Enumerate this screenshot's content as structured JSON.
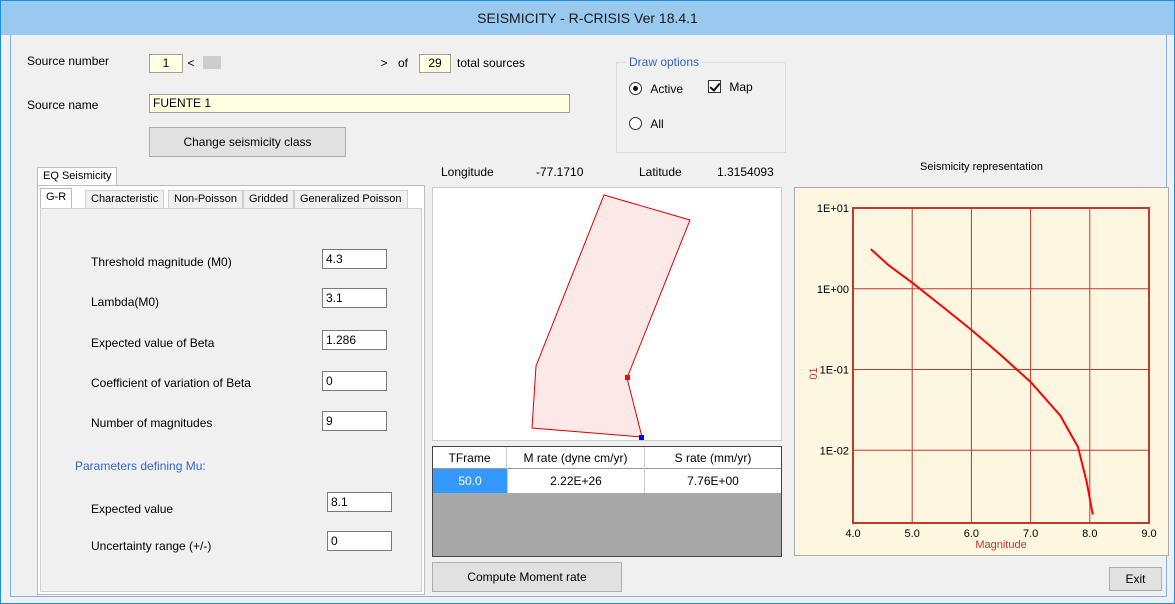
{
  "window": {
    "title": "SEISMICITY - R-CRISIS Ver 18.4.1"
  },
  "source": {
    "number_label": "Source number",
    "number_value": "1",
    "scroll_left": "<",
    "scroll_right": ">",
    "of_label": "of",
    "total_value": "29",
    "total_label": "total sources",
    "name_label": "Source name",
    "name_value": "FUENTE 1",
    "change_class_button": "Change seismicity class"
  },
  "draw_options": {
    "title": "Draw options",
    "active_label": "Active",
    "active_selected": true,
    "all_label": "All",
    "map_label": "Map",
    "map_checked": true
  },
  "tabs": {
    "outer": "EQ Seismicity",
    "inner": [
      "G-R",
      "Characteristic",
      "Non-Poisson",
      "Gridded",
      "Generalized Poisson"
    ],
    "selected": "G-R"
  },
  "gr": {
    "threshold_label": "Threshold magnitude (M0)",
    "threshold_value": "4.3",
    "lambda_label": "Lambda(M0)",
    "lambda_value": "3.1",
    "beta_label": "Expected value of Beta",
    "beta_value": "1.286",
    "cov_label": "Coefficient of variation of Beta",
    "cov_value": "0",
    "nmag_label": "Number of magnitudes",
    "nmag_value": "9",
    "mu_section": "Parameters defining Mu:",
    "mu_expected_label": "Expected value",
    "mu_expected_value": "8.1",
    "mu_range_label": "Uncertainty range (+/-)",
    "mu_range_value": "0"
  },
  "coords": {
    "lon_label": "Longitude",
    "lon_value": "-77.1710",
    "lat_label": "Latitude",
    "lat_value": "1.3154093"
  },
  "moment_table": {
    "headers": [
      "TFrame",
      "M rate (dyne cm/yr)",
      "S rate (mm/yr)"
    ],
    "rows": [
      [
        "50.0",
        "2.22E+26",
        "7.76E+00"
      ]
    ]
  },
  "compute_button": "Compute Moment rate",
  "exit_button": "Exit",
  "chart_title": "Seismicity representation",
  "chart_data": {
    "type": "line",
    "xlabel": "Magnitude",
    "ylabel": "01",
    "xlim": [
      4.0,
      9.0
    ],
    "ylim_log10": [
      -2.9,
      1.0
    ],
    "x_ticks": [
      "4.0",
      "5.0",
      "6.0",
      "7.0",
      "8.0",
      "9.0"
    ],
    "y_ticks": [
      "1E+01",
      "1E+00",
      "1E-01",
      "1E-02"
    ],
    "grid": true,
    "series": [
      {
        "x": [
          4.3,
          4.6,
          5.0,
          5.5,
          6.0,
          6.5,
          7.0,
          7.5,
          7.8,
          7.95,
          8.05
        ],
        "y": [
          3.1,
          1.96,
          1.19,
          0.61,
          0.31,
          0.15,
          0.07,
          0.027,
          0.011,
          0.004,
          0.0016
        ]
      }
    ],
    "colors": {
      "line": "#ff0000",
      "frame": "#c0392b",
      "background": "#fdf6e0"
    }
  }
}
